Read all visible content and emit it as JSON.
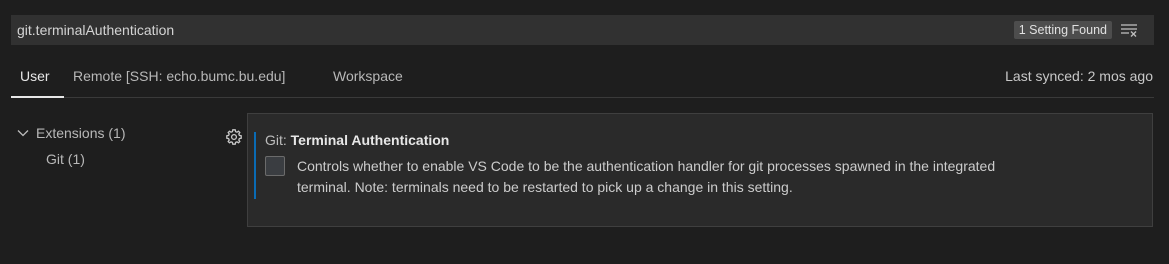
{
  "search": {
    "value": "git.terminalAuthentication",
    "result_count": "1 Setting Found"
  },
  "tabs": [
    {
      "label": "User",
      "active": true
    },
    {
      "label": "Remote [SSH: echo.bumc.bu.edu]",
      "active": false
    },
    {
      "label": "Workspace",
      "active": false
    }
  ],
  "sync_status": "Last synced: 2 mos ago",
  "toc": {
    "group_label": "Extensions (1)",
    "child_label": "Git (1)"
  },
  "setting": {
    "category": "Git: ",
    "name": "Terminal Authentication",
    "description_line1": "Controls whether to enable VS Code to be the authentication handler for git processes spawned in the integrated",
    "description_line2": "terminal. Note: terminals need to be restarted to pick up a change in this setting.",
    "checked": false
  },
  "colors": {
    "background": "#1e1e1e",
    "accent_bar": "#0a6bb4",
    "panel": "#2a2a2a"
  },
  "icons": [
    "clear-filter-icon",
    "chevron-down-icon",
    "gear-icon"
  ]
}
